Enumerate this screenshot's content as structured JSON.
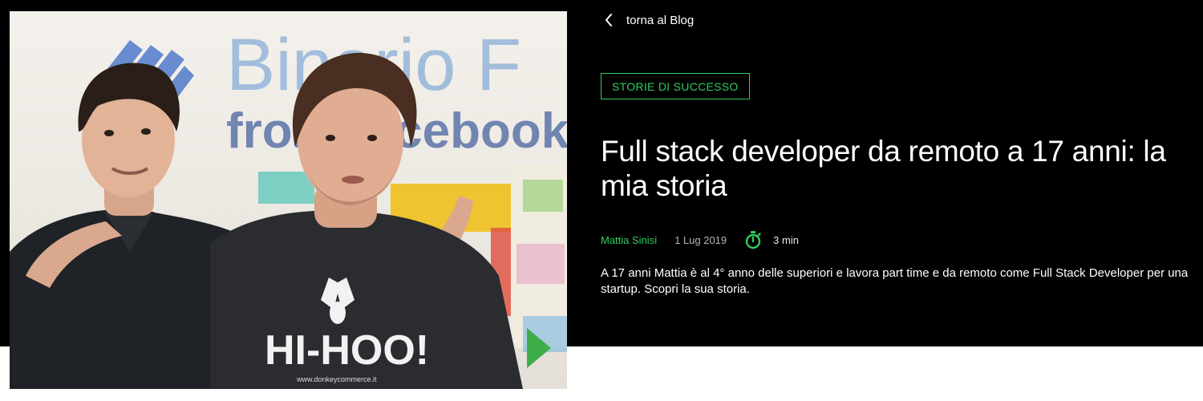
{
  "nav": {
    "back_label": "torna al Blog",
    "back_icon": "chevron-left-icon"
  },
  "post": {
    "category": "STORIE DI SUCCESSO",
    "title": "Full stack developer da remoto a 17 anni: la mia storia",
    "author": "Mattia Sinisi",
    "date": "1 Lug 2019",
    "read_time": "3 min",
    "read_time_icon": "stopwatch-icon",
    "excerpt": "A 17 anni Mattia è al 4° anno delle superiori e lavora part time e da remoto come Full Stack Developer per una startup. Scopri la sua storia."
  },
  "photo": {
    "wall_text_1": "Binario F",
    "wall_text_2": "from facebook",
    "shirt_text": "HI-HOO!",
    "shirt_small_text": "www.donkeycommerce.it"
  },
  "colors": {
    "accent": "#2ecc5e",
    "background": "#000000",
    "text": "#ffffff",
    "muted": "#b5b5b5"
  }
}
